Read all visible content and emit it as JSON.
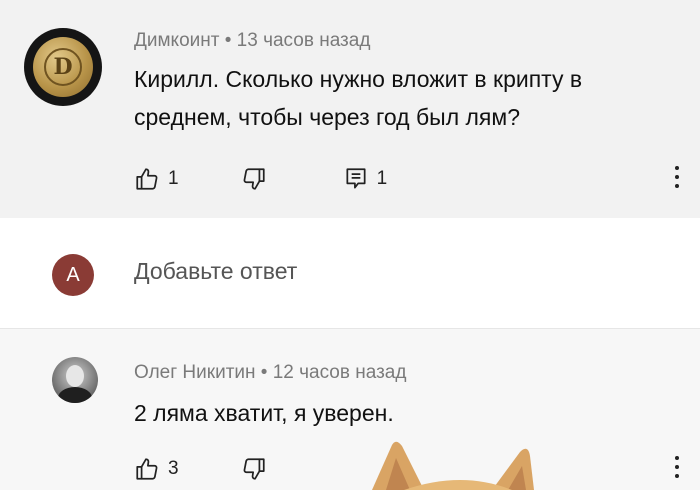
{
  "comments": [
    {
      "author": "Димкоинт",
      "time": "13 часов назад",
      "text": "Кирилл. Сколько нужно вложит в крипту в среднем, чтобы через год был лям?",
      "likes": "1",
      "replies": "1",
      "avatar_letter": "D"
    },
    {
      "author": "Олег Никитин",
      "time": "12 часов назад",
      "text": "2 ляма хватит, я уверен.",
      "likes": "3"
    }
  ],
  "reply_box": {
    "avatar_letter": "A",
    "placeholder": "Добавьте ответ"
  },
  "separator": " • ",
  "colors": {
    "comment_bg": "#f2f2f2",
    "avatar_red": "#8a3b35",
    "meta_text": "#7a7a7a",
    "coin_gold": "#b9954a",
    "cat_fur": "#d9a464"
  },
  "icons": [
    "thumbs-up-icon",
    "thumbs-down-icon",
    "reply-comment-icon",
    "more-vertical-icon"
  ]
}
